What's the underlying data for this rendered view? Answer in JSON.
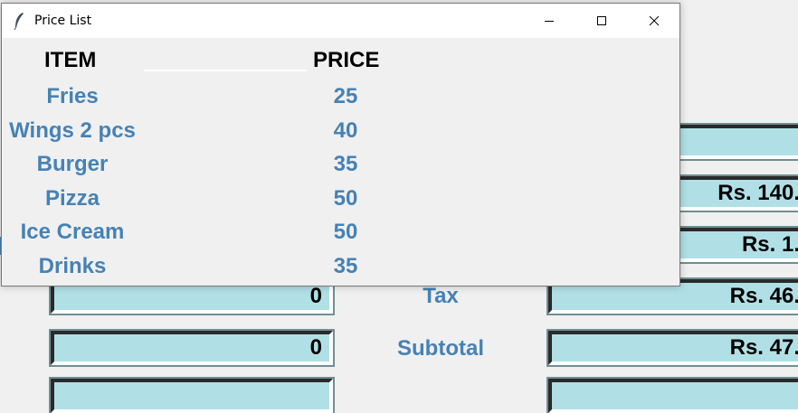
{
  "popup": {
    "title": "Price List",
    "headers": {
      "item": "ITEM",
      "price": "PRICE"
    },
    "items": [
      {
        "name": "Fries",
        "price": "25"
      },
      {
        "name": "Wings 2 pcs",
        "price": "40"
      },
      {
        "name": "Burger",
        "price": "35"
      },
      {
        "name": "Pizza",
        "price": "50"
      },
      {
        "name": "Ice Cream",
        "price": "50"
      },
      {
        "name": "Drinks",
        "price": "35"
      }
    ]
  },
  "main": {
    "right_fields": [
      "",
      "Rs. 140.",
      "Rs. 1.",
      "Rs. 46.",
      "Rs. 47."
    ],
    "left_fields": [
      "0",
      "0"
    ],
    "labels": {
      "tax": "Tax",
      "subtotal": "Subtotal"
    }
  },
  "colors": {
    "accent": "#4682b4",
    "field_bg": "#b0e0e6"
  }
}
